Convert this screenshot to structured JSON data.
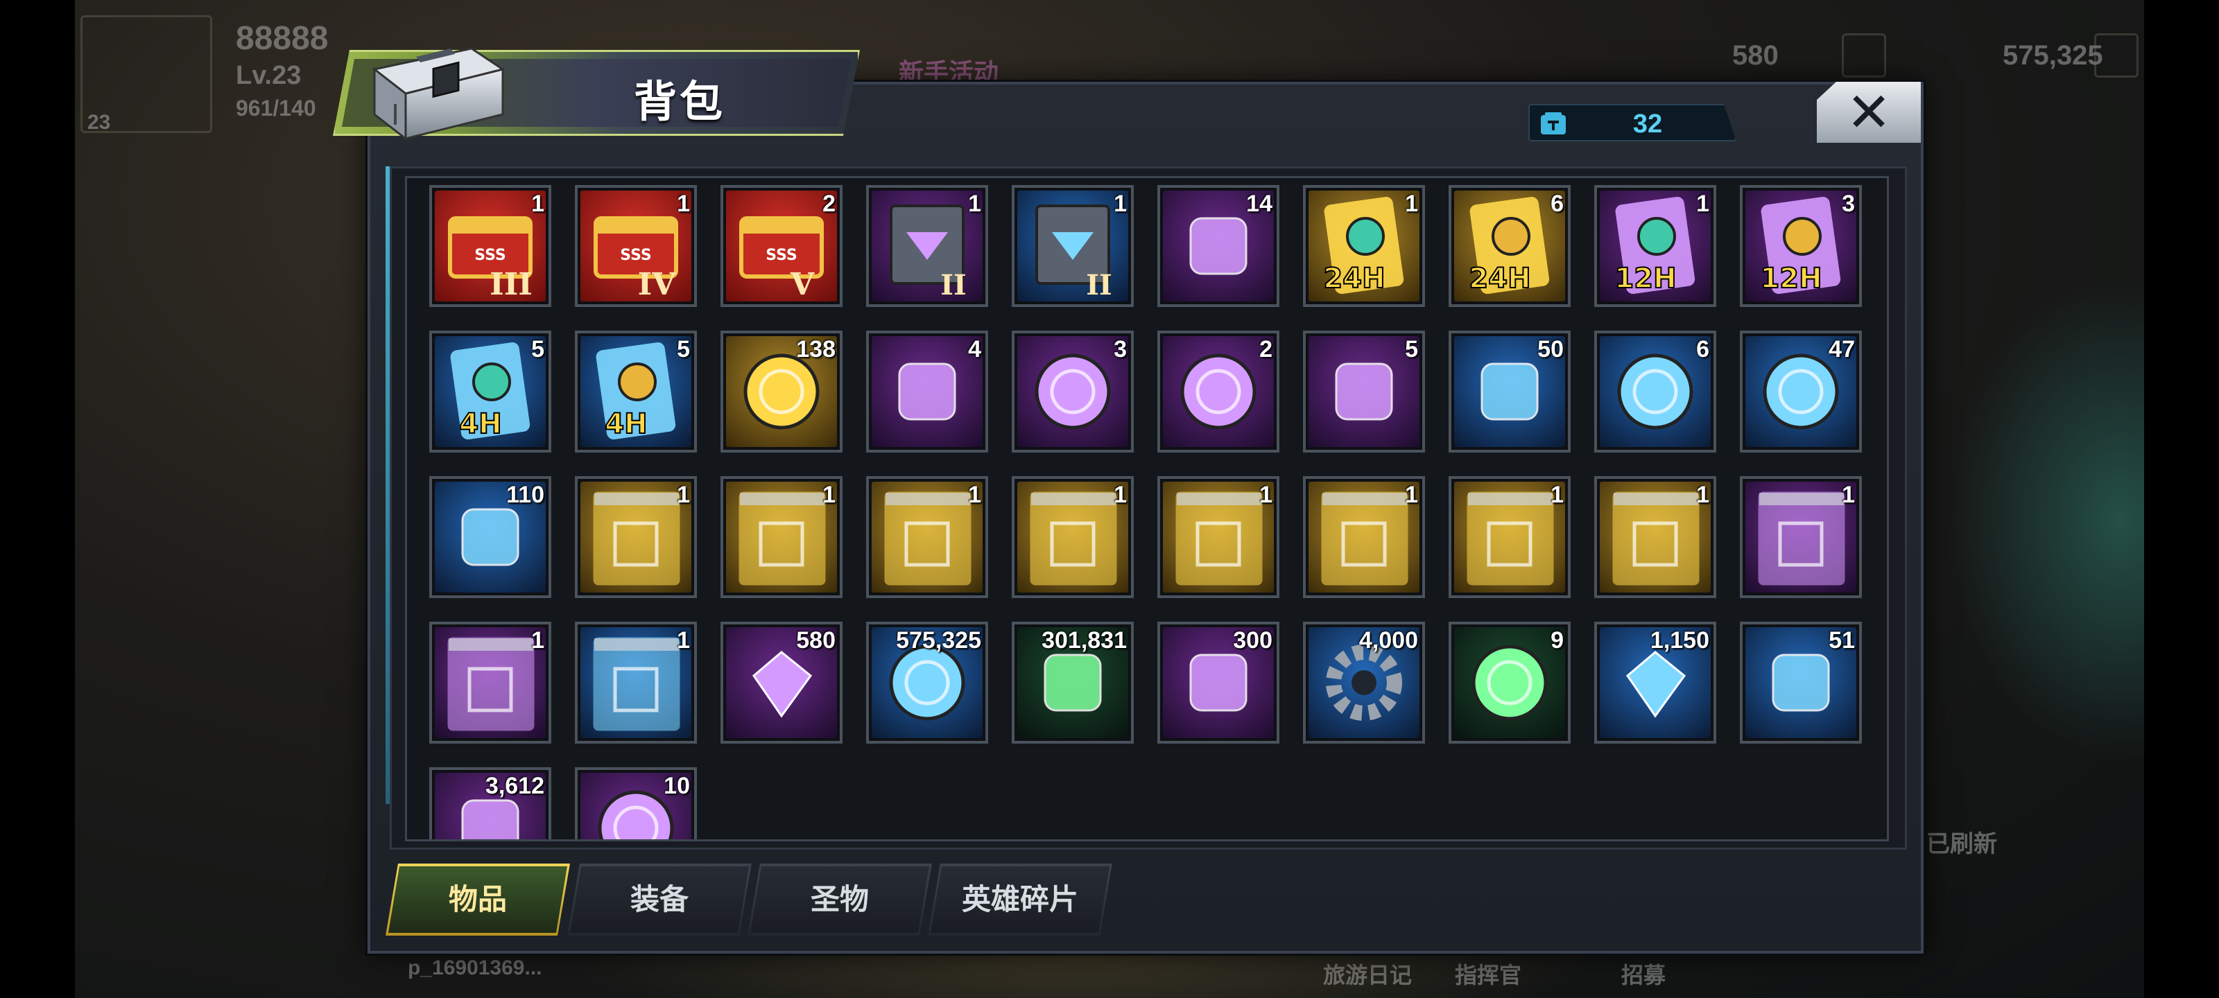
{
  "background": {
    "player_name": "88888",
    "player_level": "Lv.23",
    "player_exp": "961/140",
    "avatar_level": "23",
    "event_label": "新手活动",
    "resource_1": "580",
    "resource_2": "575,325",
    "refresh_label": "已刷新",
    "chat_snippet": "p_16901369...",
    "bottom_btn_1": "旅游日记",
    "bottom_btn_2": "指挥官",
    "bottom_btn_3": "招募"
  },
  "bag": {
    "title": "背包",
    "capacity": "32",
    "close_icon": "close-icon"
  },
  "items": [
    {
      "icon": "sss-chest-III",
      "rarity": "red",
      "qty": "1"
    },
    {
      "icon": "sss-chest-IV",
      "rarity": "red",
      "qty": "1"
    },
    {
      "icon": "sss-chest-V",
      "rarity": "red",
      "qty": "2"
    },
    {
      "icon": "purple-supply-box-II",
      "rarity": "purple",
      "qty": "1"
    },
    {
      "icon": "blue-supply-box-II",
      "rarity": "blue",
      "qty": "1"
    },
    {
      "icon": "dumbbell-swap",
      "rarity": "purple",
      "qty": "14"
    },
    {
      "icon": "speedup-card-24h-green",
      "rarity": "gold",
      "qty": "1"
    },
    {
      "icon": "speedup-card-24h-gold",
      "rarity": "gold",
      "qty": "6"
    },
    {
      "icon": "speedup-card-12h-green",
      "rarity": "purple",
      "qty": "1"
    },
    {
      "icon": "speedup-card-12h-gold",
      "rarity": "purple",
      "qty": "3"
    },
    {
      "icon": "speedup-card-4h-green",
      "rarity": "blue",
      "qty": "5"
    },
    {
      "icon": "speedup-card-4h-gold",
      "rarity": "blue",
      "qty": "5"
    },
    {
      "icon": "dragon-coin",
      "rarity": "gold",
      "qty": "138"
    },
    {
      "icon": "film-reel",
      "rarity": "purple",
      "qty": "4"
    },
    {
      "icon": "pink-bottle-cap",
      "rarity": "purple",
      "qty": "3"
    },
    {
      "icon": "spade-chip",
      "rarity": "purple",
      "qty": "2"
    },
    {
      "icon": "police-badge",
      "rarity": "purple",
      "qty": "5"
    },
    {
      "icon": "cinema-ticket",
      "rarity": "blue",
      "qty": "50"
    },
    {
      "icon": "stopwatch-token",
      "rarity": "blue",
      "qty": "6"
    },
    {
      "icon": "red-poker-chip",
      "rarity": "blue",
      "qty": "47"
    },
    {
      "icon": "bullet",
      "rarity": "blue",
      "qty": "110"
    },
    {
      "icon": "gold-blueprint-boots",
      "rarity": "gold",
      "qty": "1"
    },
    {
      "icon": "gold-blueprint-hat",
      "rarity": "gold",
      "qty": "1"
    },
    {
      "icon": "gold-blueprint-glasses",
      "rarity": "gold",
      "qty": "1"
    },
    {
      "icon": "gold-blueprint-shirt",
      "rarity": "gold",
      "qty": "1"
    },
    {
      "icon": "gold-blueprint-hat-2",
      "rarity": "gold",
      "qty": "1"
    },
    {
      "icon": "gold-blueprint-boots-2",
      "rarity": "gold",
      "qty": "1"
    },
    {
      "icon": "gold-blueprint-glasses-2",
      "rarity": "gold",
      "qty": "1"
    },
    {
      "icon": "gold-blueprint-shirt-2",
      "rarity": "gold",
      "qty": "1"
    },
    {
      "icon": "purple-blueprint-revolver",
      "rarity": "purple",
      "qty": "1"
    },
    {
      "icon": "purple-blueprint-swords",
      "rarity": "purple",
      "qty": "1"
    },
    {
      "icon": "blue-blueprint-revolver",
      "rarity": "blue",
      "qty": "1"
    },
    {
      "icon": "purple-gem",
      "rarity": "purple",
      "qty": "580"
    },
    {
      "icon": "gold-coins",
      "rarity": "blue",
      "qty": "575,325"
    },
    {
      "icon": "green-battery",
      "rarity": "green",
      "qty": "301,831"
    },
    {
      "icon": "purple-energy-core",
      "rarity": "purple",
      "qty": "300"
    },
    {
      "icon": "gear",
      "rarity": "blue",
      "qty": "4,000"
    },
    {
      "icon": "red-molecule-orb",
      "rarity": "green",
      "qty": "9"
    },
    {
      "icon": "silver-prism",
      "rarity": "blue",
      "qty": "1,150"
    },
    {
      "icon": "gold-fist-badge",
      "rarity": "blue",
      "qty": "51"
    },
    {
      "icon": "sword-shard",
      "rarity": "purple",
      "qty": "3,612"
    },
    {
      "icon": "lightning-coin",
      "rarity": "purple",
      "qty": "10"
    }
  ],
  "tabs": [
    {
      "label": "物品",
      "active": true
    },
    {
      "label": "装备",
      "active": false
    },
    {
      "label": "圣物",
      "active": false
    },
    {
      "label": "英雄碎片",
      "active": false
    }
  ],
  "colors": {
    "capacity": "#5bd1f3",
    "active_tab_border": "#f3d65a",
    "title_green": "#9db84f"
  }
}
